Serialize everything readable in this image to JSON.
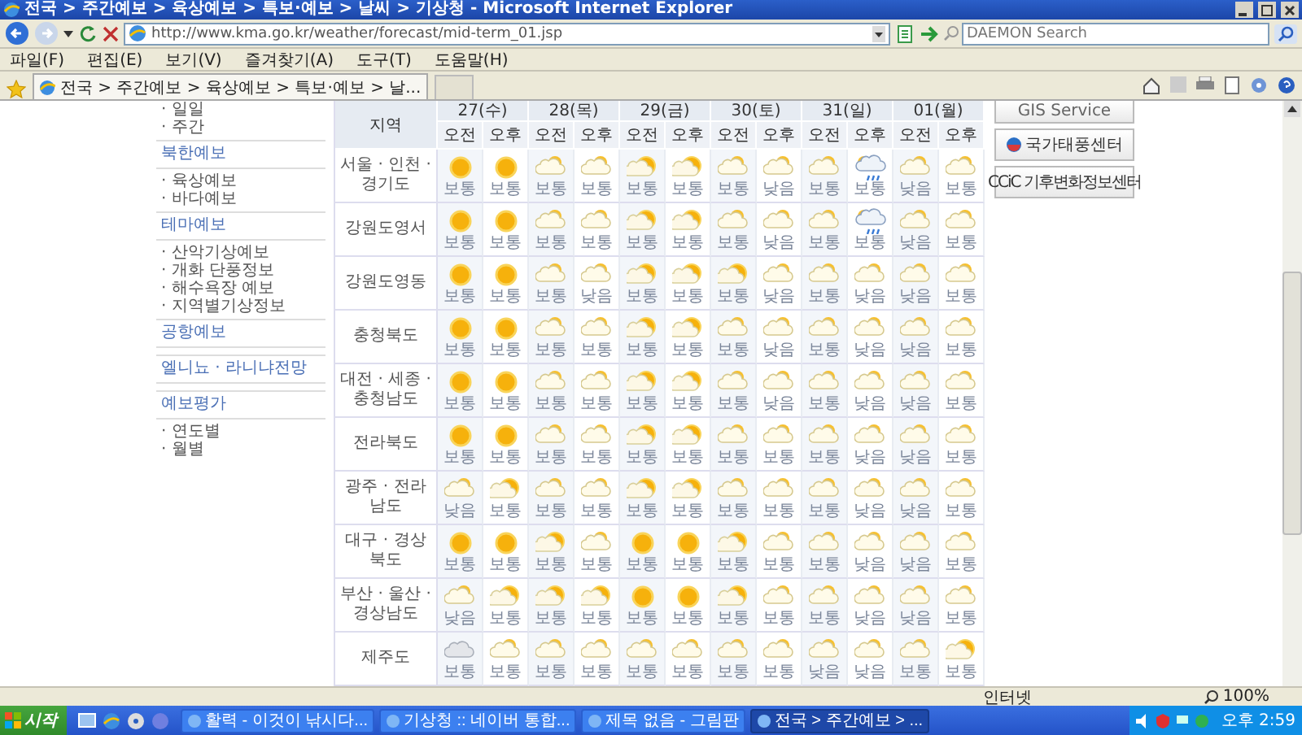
{
  "window": {
    "title": "전국 > 주간예보 > 육상예보 > 특보·예보 > 날씨 > 기상청 - Microsoft Internet Explorer"
  },
  "address_bar": {
    "url": "http://www.kma.go.kr/weather/forecast/mid-term_01.jsp"
  },
  "search": {
    "placeholder": "DAEMON Search"
  },
  "menu": [
    "파일(F)",
    "편집(E)",
    "보기(V)",
    "즐겨찾기(A)",
    "도구(T)",
    "도움말(H)"
  ],
  "tabs": [
    {
      "label": "전국 > 주간예보 > 육상예보 > 특보·예보 > 날...",
      "selected": true
    }
  ],
  "sidebar": {
    "items": [
      {
        "kind": "link",
        "label": "· 일일"
      },
      {
        "kind": "link",
        "label": "· 주간"
      },
      {
        "kind": "heading",
        "label": "북한예보"
      },
      {
        "kind": "link",
        "label": "· 육상예보"
      },
      {
        "kind": "link",
        "label": "· 바다예보"
      },
      {
        "kind": "heading",
        "label": "테마예보"
      },
      {
        "kind": "link",
        "label": "· 산악기상예보"
      },
      {
        "kind": "link",
        "label": "· 개화 단풍정보"
      },
      {
        "kind": "link",
        "label": "· 해수욕장 예보"
      },
      {
        "kind": "link",
        "label": "· 지역별기상정보"
      },
      {
        "kind": "heading",
        "label": "공항예보"
      },
      {
        "kind": "heading",
        "label": "엘니뇨 · 라니냐전망"
      },
      {
        "kind": "heading",
        "label": "예보평가"
      },
      {
        "kind": "link",
        "label": "· 연도별"
      },
      {
        "kind": "link",
        "label": "· 월별"
      }
    ]
  },
  "table": {
    "region_header": "지역",
    "days": [
      "27(수)",
      "28(목)",
      "29(금)",
      "30(토)",
      "31(일)",
      "01(월)"
    ],
    "periods": [
      "오전",
      "오후",
      "오전",
      "오후",
      "오전",
      "오후",
      "오전",
      "오후",
      "오전",
      "오후",
      "오전",
      "오후"
    ],
    "rows": [
      {
        "region": "서울 · 인천 · 경기도",
        "cells": [
          {
            "kind": "sunny",
            "index": "보통"
          },
          {
            "kind": "sunny",
            "index": "보통"
          },
          {
            "kind": "cloudy",
            "index": "보통"
          },
          {
            "kind": "cloudy",
            "index": "보통"
          },
          {
            "kind": "partly",
            "index": "보통"
          },
          {
            "kind": "partly",
            "index": "보통"
          },
          {
            "kind": "cloudy",
            "index": "보통"
          },
          {
            "kind": "cloudy",
            "index": "낮음"
          },
          {
            "kind": "cloudy",
            "index": "보통"
          },
          {
            "kind": "shower",
            "index": "보통"
          },
          {
            "kind": "cloudy",
            "index": "낮음"
          },
          {
            "kind": "cloudy",
            "index": "보통"
          }
        ]
      },
      {
        "region": "강원도영서",
        "cells": [
          {
            "kind": "sunny",
            "index": "보통"
          },
          {
            "kind": "sunny",
            "index": "보통"
          },
          {
            "kind": "cloudy",
            "index": "보통"
          },
          {
            "kind": "cloudy",
            "index": "보통"
          },
          {
            "kind": "partly",
            "index": "보통"
          },
          {
            "kind": "partly",
            "index": "보통"
          },
          {
            "kind": "cloudy",
            "index": "보통"
          },
          {
            "kind": "cloudy",
            "index": "낮음"
          },
          {
            "kind": "cloudy",
            "index": "보통"
          },
          {
            "kind": "shower",
            "index": "보통"
          },
          {
            "kind": "cloudy",
            "index": "낮음"
          },
          {
            "kind": "cloudy",
            "index": "보통"
          }
        ]
      },
      {
        "region": "강원도영동",
        "cells": [
          {
            "kind": "sunny",
            "index": "보통"
          },
          {
            "kind": "sunny",
            "index": "보통"
          },
          {
            "kind": "cloudy",
            "index": "보통"
          },
          {
            "kind": "cloudy",
            "index": "낮음"
          },
          {
            "kind": "partly",
            "index": "보통"
          },
          {
            "kind": "partly",
            "index": "보통"
          },
          {
            "kind": "partly",
            "index": "보통"
          },
          {
            "kind": "cloudy",
            "index": "낮음"
          },
          {
            "kind": "cloudy",
            "index": "보통"
          },
          {
            "kind": "cloudy",
            "index": "낮음"
          },
          {
            "kind": "cloudy",
            "index": "낮음"
          },
          {
            "kind": "cloudy",
            "index": "보통"
          }
        ]
      },
      {
        "region": "충청북도",
        "cells": [
          {
            "kind": "sunny",
            "index": "보통"
          },
          {
            "kind": "sunny",
            "index": "보통"
          },
          {
            "kind": "cloudy",
            "index": "보통"
          },
          {
            "kind": "cloudy",
            "index": "보통"
          },
          {
            "kind": "partly",
            "index": "보통"
          },
          {
            "kind": "partly",
            "index": "보통"
          },
          {
            "kind": "cloudy",
            "index": "보통"
          },
          {
            "kind": "cloudy",
            "index": "낮음"
          },
          {
            "kind": "cloudy",
            "index": "보통"
          },
          {
            "kind": "cloudy",
            "index": "낮음"
          },
          {
            "kind": "cloudy",
            "index": "낮음"
          },
          {
            "kind": "cloudy",
            "index": "보통"
          }
        ]
      },
      {
        "region": "대전 · 세종 · 충청남도",
        "cells": [
          {
            "kind": "sunny",
            "index": "보통"
          },
          {
            "kind": "sunny",
            "index": "보통"
          },
          {
            "kind": "cloudy",
            "index": "보통"
          },
          {
            "kind": "cloudy",
            "index": "보통"
          },
          {
            "kind": "partly",
            "index": "보통"
          },
          {
            "kind": "partly",
            "index": "보통"
          },
          {
            "kind": "cloudy",
            "index": "보통"
          },
          {
            "kind": "cloudy",
            "index": "낮음"
          },
          {
            "kind": "cloudy",
            "index": "보통"
          },
          {
            "kind": "cloudy",
            "index": "낮음"
          },
          {
            "kind": "cloudy",
            "index": "낮음"
          },
          {
            "kind": "cloudy",
            "index": "보통"
          }
        ]
      },
      {
        "region": "전라북도",
        "cells": [
          {
            "kind": "sunny",
            "index": "보통"
          },
          {
            "kind": "sunny",
            "index": "보통"
          },
          {
            "kind": "cloudy",
            "index": "보통"
          },
          {
            "kind": "cloudy",
            "index": "보통"
          },
          {
            "kind": "partly",
            "index": "보통"
          },
          {
            "kind": "partly",
            "index": "보통"
          },
          {
            "kind": "cloudy",
            "index": "보통"
          },
          {
            "kind": "cloudy",
            "index": "보통"
          },
          {
            "kind": "cloudy",
            "index": "보통"
          },
          {
            "kind": "cloudy",
            "index": "낮음"
          },
          {
            "kind": "cloudy",
            "index": "낮음"
          },
          {
            "kind": "cloudy",
            "index": "보통"
          }
        ]
      },
      {
        "region": "광주 · 전라남도",
        "cells": [
          {
            "kind": "cloudy",
            "index": "낮음"
          },
          {
            "kind": "partly",
            "index": "보통"
          },
          {
            "kind": "cloudy",
            "index": "보통"
          },
          {
            "kind": "cloudy",
            "index": "보통"
          },
          {
            "kind": "partly",
            "index": "보통"
          },
          {
            "kind": "partly",
            "index": "보통"
          },
          {
            "kind": "cloudy",
            "index": "보통"
          },
          {
            "kind": "cloudy",
            "index": "보통"
          },
          {
            "kind": "cloudy",
            "index": "보통"
          },
          {
            "kind": "cloudy",
            "index": "낮음"
          },
          {
            "kind": "cloudy",
            "index": "낮음"
          },
          {
            "kind": "cloudy",
            "index": "보통"
          }
        ]
      },
      {
        "region": "대구 · 경상북도",
        "cells": [
          {
            "kind": "sunny",
            "index": "보통"
          },
          {
            "kind": "sunny",
            "index": "보통"
          },
          {
            "kind": "partly",
            "index": "보통"
          },
          {
            "kind": "cloudy",
            "index": "보통"
          },
          {
            "kind": "sunny",
            "index": "보통"
          },
          {
            "kind": "sunny",
            "index": "보통"
          },
          {
            "kind": "partly",
            "index": "보통"
          },
          {
            "kind": "cloudy",
            "index": "보통"
          },
          {
            "kind": "cloudy",
            "index": "보통"
          },
          {
            "kind": "cloudy",
            "index": "낮음"
          },
          {
            "kind": "cloudy",
            "index": "낮음"
          },
          {
            "kind": "cloudy",
            "index": "보통"
          }
        ]
      },
      {
        "region": "부산 · 울산 · 경상남도",
        "cells": [
          {
            "kind": "cloudy",
            "index": "낮음"
          },
          {
            "kind": "partly",
            "index": "보통"
          },
          {
            "kind": "partly",
            "index": "보통"
          },
          {
            "kind": "partly",
            "index": "보통"
          },
          {
            "kind": "sunny",
            "index": "보통"
          },
          {
            "kind": "sunny",
            "index": "보통"
          },
          {
            "kind": "partly",
            "index": "보통"
          },
          {
            "kind": "cloudy",
            "index": "보통"
          },
          {
            "kind": "cloudy",
            "index": "보통"
          },
          {
            "kind": "cloudy",
            "index": "낮음"
          },
          {
            "kind": "cloudy",
            "index": "낮음"
          },
          {
            "kind": "cloudy",
            "index": "보통"
          }
        ]
      },
      {
        "region": "제주도",
        "cells": [
          {
            "kind": "overcast",
            "index": "보통"
          },
          {
            "kind": "cloudy",
            "index": "보통"
          },
          {
            "kind": "cloudy",
            "index": "보통"
          },
          {
            "kind": "cloudy",
            "index": "보통"
          },
          {
            "kind": "cloudy",
            "index": "보통"
          },
          {
            "kind": "cloudy",
            "index": "보통"
          },
          {
            "kind": "cloudy",
            "index": "보통"
          },
          {
            "kind": "cloudy",
            "index": "보통"
          },
          {
            "kind": "cloudy",
            "index": "낮음"
          },
          {
            "kind": "cloudy",
            "index": "낮음"
          },
          {
            "kind": "cloudy",
            "index": "보통"
          },
          {
            "kind": "partly",
            "index": "보통"
          }
        ]
      }
    ]
  },
  "banners": [
    {
      "kind": "gis",
      "label": "GIS Service"
    },
    {
      "kind": "typhoon",
      "label": "국가태풍센터"
    },
    {
      "kind": "climate",
      "label": "CCiC 기후변화정보센터"
    }
  ],
  "status_bar": {
    "zone": "인터넷",
    "zoom": "100%"
  },
  "taskbar": {
    "start": "시작",
    "tasks": [
      {
        "label": "활력 - 이것이 낚시다...",
        "selected": false
      },
      {
        "label": "기상청 :: 네이버 통합...",
        "selected": false
      },
      {
        "label": "제목 없음 - 그림판",
        "selected": false
      },
      {
        "label": "전국 > 주간예보 > ...",
        "selected": true
      }
    ],
    "clock": "오후 2:59"
  }
}
